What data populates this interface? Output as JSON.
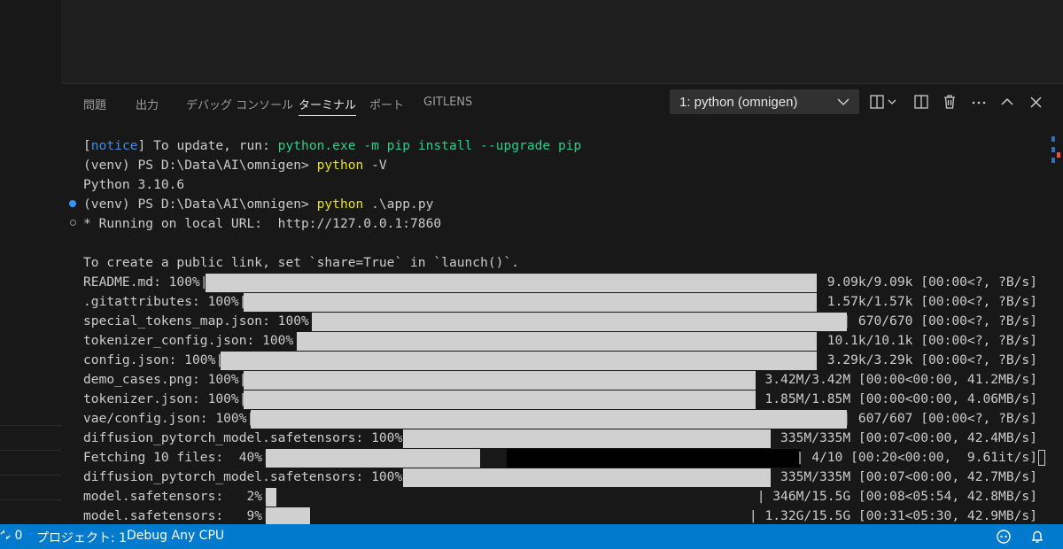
{
  "panel": {
    "tabs": [
      {
        "label": "問題",
        "active": false
      },
      {
        "label": "出力",
        "active": false
      },
      {
        "label": "デバッグ コンソール",
        "active": false
      },
      {
        "label": "ターミナル",
        "active": true
      },
      {
        "label": "ポート",
        "active": false
      },
      {
        "label": "GITLENS",
        "active": false
      }
    ],
    "terminal_select": "1: python (omnigen)",
    "icons": [
      "split-terminal-dropdown-icon",
      "split-editor-icon",
      "trash-icon",
      "more-actions-icon",
      "chevron-up-icon",
      "close-icon"
    ]
  },
  "terminal": {
    "notice_open": "[",
    "notice_word": "notice",
    "notice_rest": "] To update, run: ",
    "notice_cmd": "python.exe -m pip install --upgrade pip",
    "prompt": "(venv) PS D:\\Data\\AI\\omnigen> ",
    "cmd1": "python",
    "cmd1_arg": " -V",
    "python_version": "Python 3.10.6",
    "cmd2": "python",
    "cmd2_arg": " .\\app.py",
    "running": "* Running on local URL:  http://127.0.0.1:7860",
    "public_link": "To create a public link, set `share=True` in `launch()`.",
    "progress": [
      {
        "label": "README.md: 100%|",
        "stats": "| 9.09k/9.09k [00:00<?, ?B/s]",
        "fraction": 1.0
      },
      {
        "label": ".gitattributes: 100%|",
        "stats": "| 1.57k/1.57k [00:00<?, ?B/s]",
        "fraction": 1.0
      },
      {
        "label": "special_tokens_map.json: 100%|",
        "stats": "| 670/670 [00:00<?, ?B/s]",
        "fraction": 1.0
      },
      {
        "label": "tokenizer_config.json: 100%|",
        "stats": "| 10.1k/10.1k [00:00<?, ?B/s]",
        "fraction": 1.0
      },
      {
        "label": "config.json: 100%|",
        "stats": "| 3.29k/3.29k [00:00<?, ?B/s]",
        "fraction": 1.0
      },
      {
        "label": "demo_cases.png: 100%|",
        "stats": "| 3.42M/3.42M [00:00<00:00, 41.2MB/s]",
        "fraction": 1.0
      },
      {
        "label": "tokenizer.json: 100%|",
        "stats": "| 1.85M/1.85M [00:00<00:00, 4.06MB/s]",
        "fraction": 1.0
      },
      {
        "label": "vae/config.json: 100%|",
        "stats": "| 607/607 [00:00<?, ?B/s]",
        "fraction": 1.0
      },
      {
        "label": "diffusion_pytorch_model.safetensors: 100%|",
        "stats": "| 335M/335M [00:07<00:00, 42.4MB/s]",
        "fraction": 1.0
      },
      {
        "label": "Fetching 10 files:  40%|",
        "stats": "| 4/10 [00:20<00:00,  9.61it/s]",
        "fraction": 0.4
      },
      {
        "label": "diffusion_pytorch_model.safetensors: 100%|",
        "stats": "| 335M/335M [00:07<00:00, 42.7MB/s]",
        "fraction": 1.0
      },
      {
        "label": "model.safetensors:   2%|",
        "stats": "| 346M/15.5G [00:08<05:54, 42.8MB/s]",
        "fraction": 0.02
      },
      {
        "label": "model.safetensors:   9%|",
        "stats": "| 1.32G/15.5G [00:31<05:30, 42.9MB/s]",
        "fraction": 0.09
      }
    ]
  },
  "statusbar": {
    "left": [
      {
        "icon": "remote-icon",
        "label": "0"
      },
      {
        "label": "プロジェクト: 1"
      },
      {
        "label": "Debug Any CPU"
      }
    ],
    "right_icons": [
      "copilot-icon",
      "bell-icon"
    ]
  },
  "colors": {
    "accent": "#007acc",
    "panel_bg": "#181818",
    "bar": "#d0d0d0"
  }
}
